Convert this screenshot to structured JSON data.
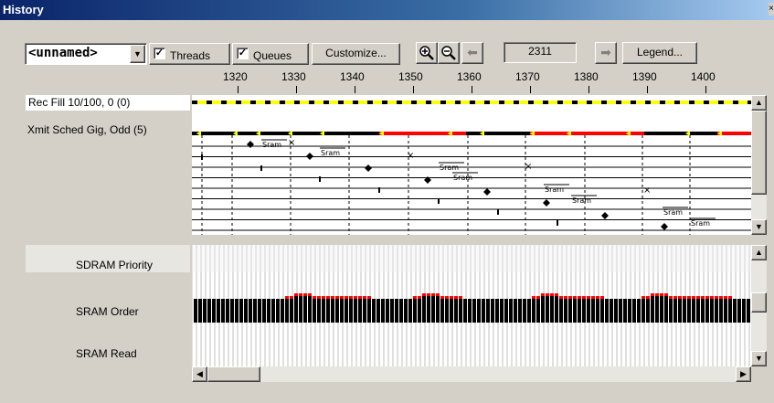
{
  "window": {
    "title": "History"
  },
  "toolbar": {
    "combo_value": "<unnamed>",
    "threads_label": "Threads",
    "threads_checked": true,
    "queues_label": "Queues",
    "queues_checked": true,
    "customize_label": "Customize...",
    "cycle_value": "2311",
    "legend_label": "Legend..."
  },
  "ruler": {
    "ticks": [
      "1320",
      "1330",
      "1340",
      "1350",
      "1360",
      "1370",
      "1380",
      "1390",
      "1400"
    ]
  },
  "upper_panel": {
    "rows": [
      "Rec Fill 10/100, 0 (0)",
      "Xmit Sched Gig, Odd (5)"
    ],
    "sram_label": "Sram"
  },
  "lower_panel": {
    "rows": [
      "SDRAM Priority",
      "SRAM Order",
      "SRAM Read"
    ]
  },
  "colors": {
    "yellow": "#ffff00",
    "red": "#ff0000",
    "black": "#000000",
    "grid": "#c0c0c0"
  },
  "icons": [
    "zoom-in-icon",
    "zoom-out-icon",
    "arrow-left-icon",
    "arrow-right-icon",
    "dropdown-arrow-icon",
    "checkmark-icon",
    "scroll-up-icon",
    "scroll-down-icon",
    "scroll-left-icon",
    "scroll-right-icon"
  ]
}
